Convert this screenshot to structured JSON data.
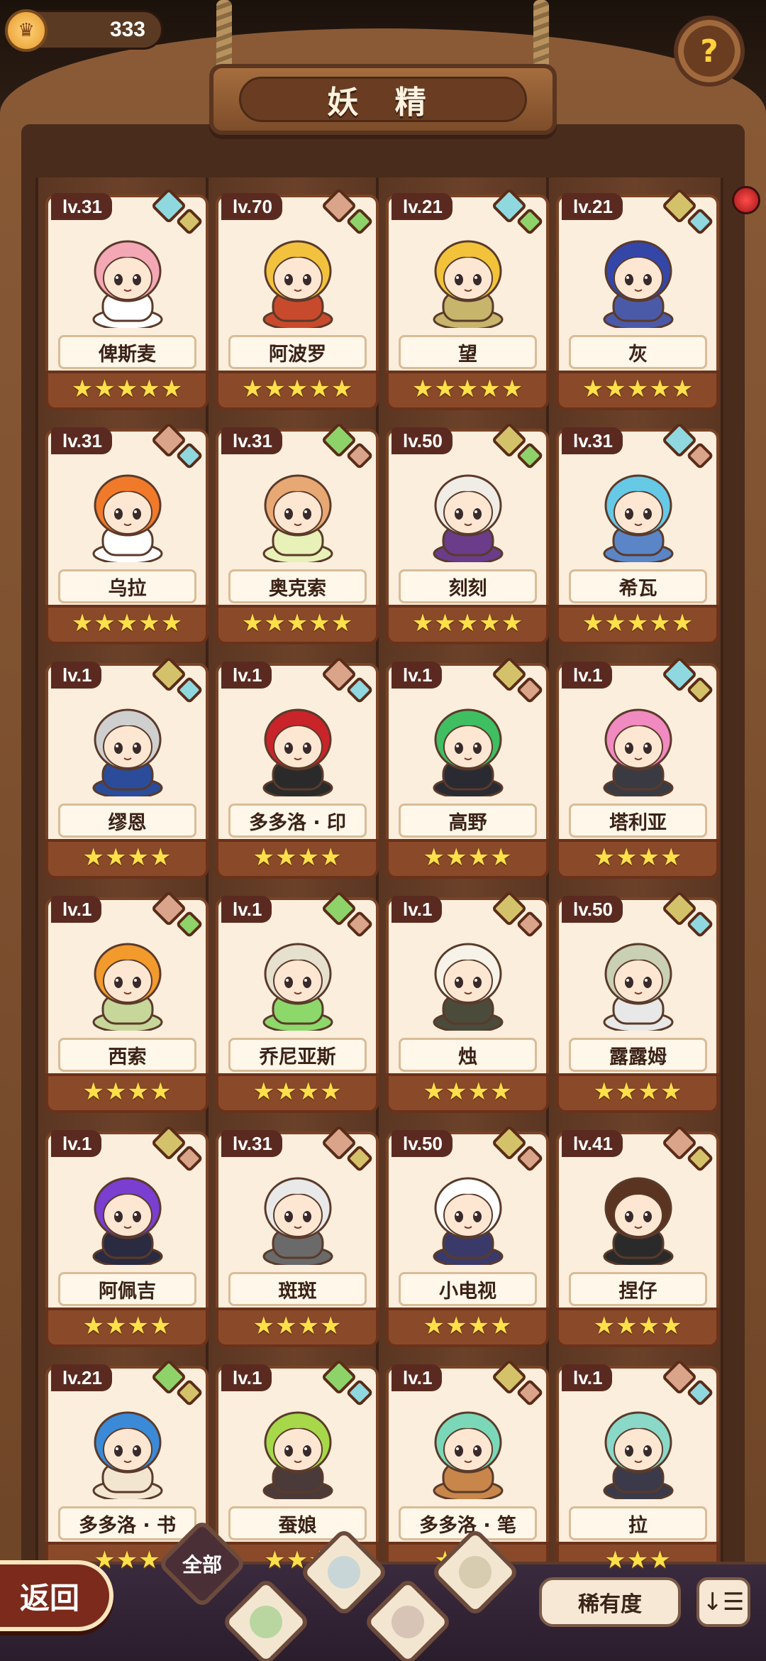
{
  "header": {
    "currency_value": "333",
    "title": "妖 精"
  },
  "cards": [
    {
      "level": "lv.31",
      "name": "俾斯麦",
      "stars": "★★★★★",
      "el1": "water",
      "el2": "earth",
      "hair": "#f4a7b5",
      "outfit": "#ffffff"
    },
    {
      "level": "lv.70",
      "name": "阿波罗",
      "stars": "★★★★★",
      "el1": "mountain",
      "el2": "grass",
      "hair": "#f2c23e",
      "outfit": "#c84a2c"
    },
    {
      "level": "lv.21",
      "name": "望",
      "stars": "★★★★★",
      "el1": "water",
      "el2": "grass",
      "hair": "#f2c33a",
      "outfit": "#c7b56c"
    },
    {
      "level": "lv.21",
      "name": "灰",
      "stars": "★★★★★",
      "el1": "earth",
      "el2": "water",
      "hair": "#3447a8",
      "outfit": "#4b5aa8"
    },
    {
      "level": "lv.31",
      "name": "乌拉",
      "stars": "★★★★★",
      "el1": "mountain",
      "el2": "water",
      "hair": "#f07a2a",
      "outfit": "#ffffff"
    },
    {
      "level": "lv.31",
      "name": "奥克索",
      "stars": "★★★★★",
      "el1": "grass",
      "el2": "mountain",
      "hair": "#e7a874",
      "outfit": "#e8f1b8"
    },
    {
      "level": "lv.50",
      "name": "刻刻",
      "stars": "★★★★★",
      "el1": "earth",
      "el2": "grass",
      "hair": "#f0ece6",
      "outfit": "#6a3c8a"
    },
    {
      "level": "lv.31",
      "name": "希瓦",
      "stars": "★★★★★",
      "el1": "water",
      "el2": "mountain",
      "hair": "#66c9e6",
      "outfit": "#5a86c8"
    },
    {
      "level": "lv.1",
      "name": "缪恩",
      "stars": "★★★★",
      "el1": "earth",
      "el2": "water",
      "hair": "#cfcfcf",
      "outfit": "#2a4c9a"
    },
    {
      "level": "lv.1",
      "name": "多多洛 · 印",
      "stars": "★★★★",
      "el1": "mountain",
      "el2": "water",
      "hair": "#c8242a",
      "outfit": "#2a2a2a"
    },
    {
      "level": "lv.1",
      "name": "高野",
      "stars": "★★★★",
      "el1": "earth",
      "el2": "mountain",
      "hair": "#3fbf62",
      "outfit": "#2a2a32"
    },
    {
      "level": "lv.1",
      "name": "塔利亚",
      "stars": "★★★★",
      "el1": "water",
      "el2": "earth",
      "hair": "#f08ac0",
      "outfit": "#3a3a42"
    },
    {
      "level": "lv.1",
      "name": "西索",
      "stars": "★★★★",
      "el1": "mountain",
      "el2": "grass",
      "hair": "#f29a2c",
      "outfit": "#c7d79a"
    },
    {
      "level": "lv.1",
      "name": "乔尼亚斯",
      "stars": "★★★★",
      "el1": "grass",
      "el2": "mountain",
      "hair": "#e6e1cf",
      "outfit": "#8dd86a"
    },
    {
      "level": "lv.1",
      "name": "烛",
      "stars": "★★★★",
      "el1": "earth",
      "el2": "mountain",
      "hair": "#f7f3e8",
      "outfit": "#4b4b3c"
    },
    {
      "level": "lv.50",
      "name": "露露姆",
      "stars": "★★★★",
      "el1": "earth",
      "el2": "water",
      "hair": "#c9d0b4",
      "outfit": "#e8e8e8"
    },
    {
      "level": "lv.1",
      "name": "阿佩吉",
      "stars": "★★★★",
      "el1": "earth",
      "el2": "mountain",
      "hair": "#7a3ed0",
      "outfit": "#2a2a40"
    },
    {
      "level": "lv.31",
      "name": "斑斑",
      "stars": "★★★★",
      "el1": "mountain",
      "el2": "earth",
      "hair": "#e9e9e9",
      "outfit": "#6a6a6a"
    },
    {
      "level": "lv.50",
      "name": "小电视",
      "stars": "★★★★",
      "el1": "earth",
      "el2": "mountain",
      "hair": "#ffffff",
      "outfit": "#3a3a6a"
    },
    {
      "level": "lv.41",
      "name": "捏仔",
      "stars": "★★★★",
      "el1": "mountain",
      "el2": "earth",
      "hair": "#5a3420",
      "outfit": "#2a2a2a"
    },
    {
      "level": "lv.21",
      "name": "多多洛 · 书",
      "stars": "★★★",
      "el1": "grass",
      "el2": "earth",
      "hair": "#3a8ad8",
      "outfit": "#f2e6d0"
    },
    {
      "level": "lv.1",
      "name": "蚕娘",
      "stars": "★★★",
      "el1": "grass",
      "el2": "water",
      "hair": "#a6d84a",
      "outfit": "#4a3a3a"
    },
    {
      "level": "lv.1",
      "name": "多多洛 · 笔",
      "stars": "★★★",
      "el1": "earth",
      "el2": "mountain",
      "hair": "#7ad8b8",
      "outfit": "#c8864a"
    },
    {
      "level": "lv.1",
      "name": "拉",
      "stars": "★★★",
      "el1": "mountain",
      "el2": "water",
      "hair": "#8ad8c8",
      "outfit": "#3a3a4a"
    }
  ],
  "footer": {
    "back_label": "返回",
    "tab_all_label": "全部",
    "rarity_label": "稀有度",
    "sort_icon": "↓☰"
  },
  "colors": {
    "water": "#8fd8df",
    "grass": "#8ed36a",
    "earth": "#d4c26b",
    "mountain": "#d9a48a"
  }
}
